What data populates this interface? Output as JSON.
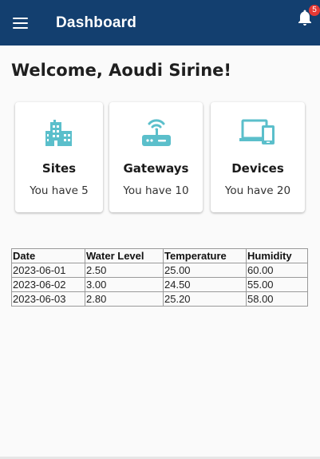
{
  "appbar": {
    "title": "Dashboard",
    "notification_count": "5",
    "icons": {
      "menu": "menu-icon",
      "notifications": "bell-icon"
    },
    "colors": {
      "background": "#133f6f",
      "badge": "#e53935"
    }
  },
  "welcome": {
    "text": "Welcome, Aoudi Sirine!"
  },
  "cards": [
    {
      "title": "Sites",
      "subtitle": "You have 5",
      "icon": "building-icon"
    },
    {
      "title": "Gateways",
      "subtitle": "You have 10",
      "icon": "router-icon"
    },
    {
      "title": "Devices",
      "subtitle": "You have 20",
      "icon": "devices-icon"
    }
  ],
  "accent_color": "#5bbfcb",
  "table": {
    "headers": [
      "Date",
      "Water Level",
      "Temperature",
      "Humidity"
    ],
    "rows": [
      [
        "2023-06-01",
        "2.50",
        "25.00",
        "60.00"
      ],
      [
        "2023-06-02",
        "3.00",
        "24.50",
        "55.00"
      ],
      [
        "2023-06-03",
        "2.80",
        "25.20",
        "58.00"
      ]
    ]
  }
}
